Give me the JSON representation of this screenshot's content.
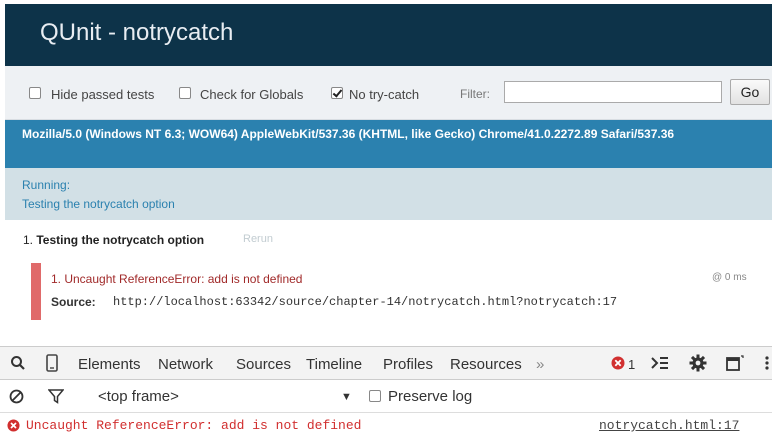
{
  "qunit": {
    "title": "QUnit - notrycatch",
    "toolbar": {
      "hide_passed_label": "Hide passed tests",
      "check_globals_label": "Check for Globals",
      "no_try_catch_label": "No try-catch",
      "hide_passed_checked": false,
      "check_globals_checked": false,
      "no_try_catch_checked": true,
      "filter_label": "Filter:",
      "filter_value": "",
      "go_label": "Go"
    },
    "user_agent": "Mozilla/5.0 (Windows NT 6.3; WOW64) AppleWebKit/537.36 (KHTML, like Gecko) Chrome/41.0.2272.89 Safari/537.36",
    "status": {
      "line1": "Running:",
      "line2": "Testing the notrycatch option"
    },
    "test": {
      "number": "1.",
      "name": "Testing the notrycatch option",
      "rerun": "Rerun",
      "assertion": "1. Uncaught ReferenceError: add is not defined",
      "time": "@ 0 ms",
      "source_label": "Source:",
      "source_value": "http://localhost:63342/source/chapter-14/notrycatch.html?notrycatch:17"
    }
  },
  "devtools": {
    "tabs": [
      "Elements",
      "Network",
      "Sources",
      "Timeline",
      "Profiles",
      "Resources"
    ],
    "more": "»",
    "error_count": "1",
    "frame": "<top frame>",
    "preserve_log_label": "Preserve log",
    "console": {
      "message": "Uncaught ReferenceError: add is not defined",
      "link": "notrycatch.html:17"
    },
    "colors": {
      "error": "#d12f2f"
    }
  }
}
